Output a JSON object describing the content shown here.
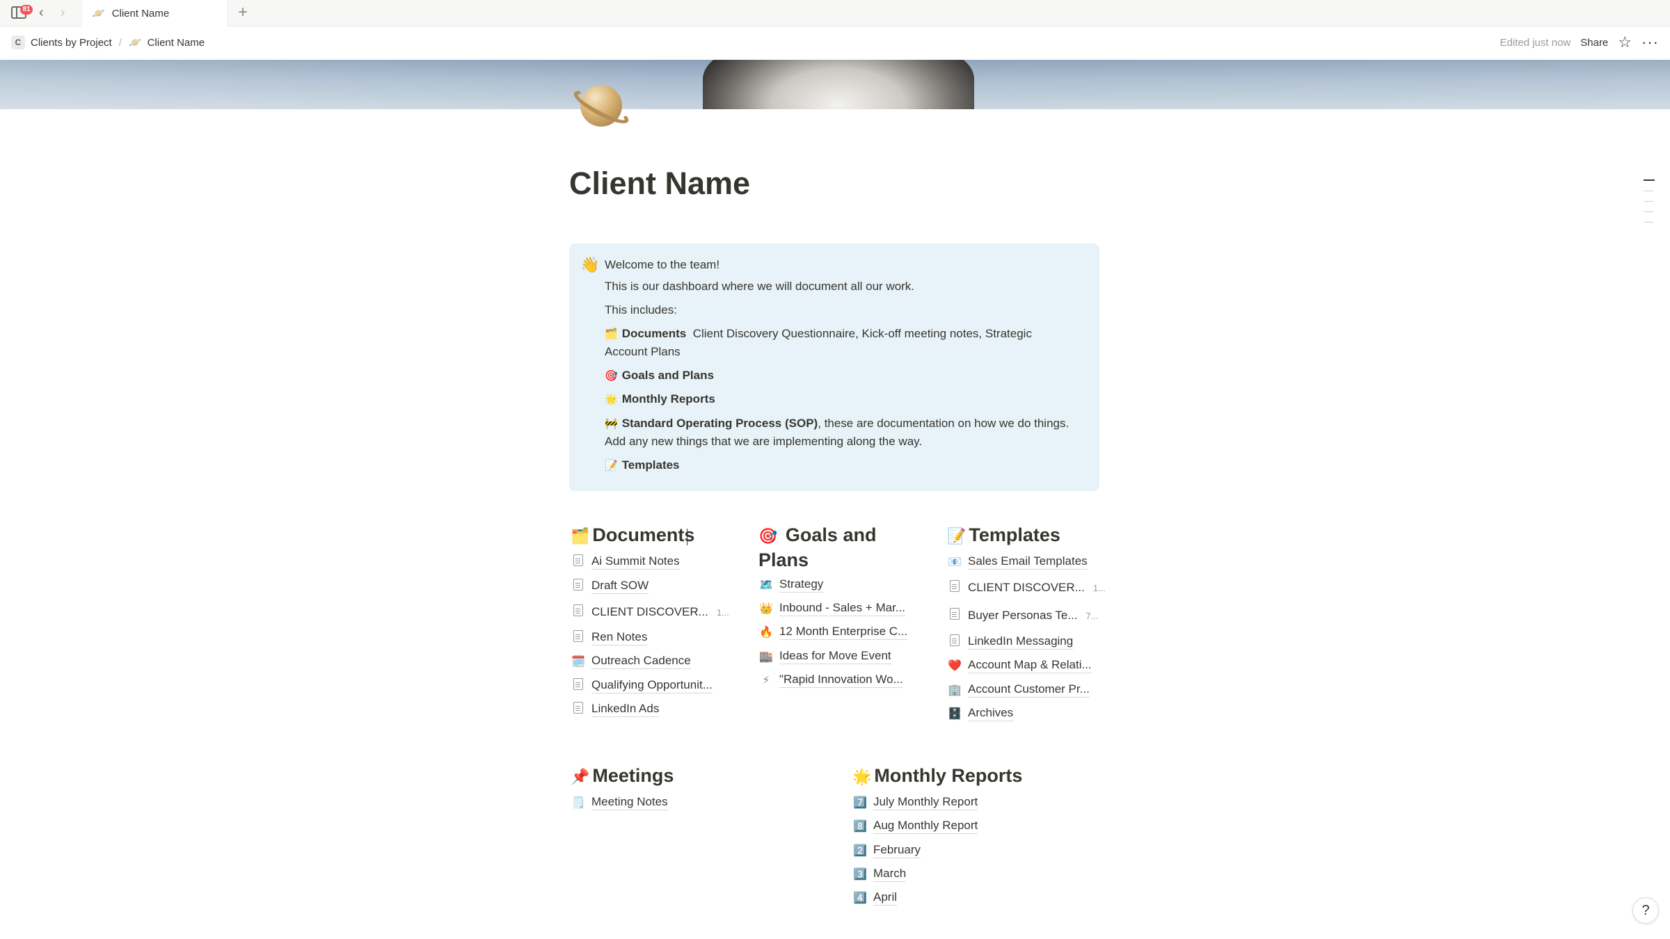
{
  "tabbar": {
    "badge": "81",
    "back_glyph": "‹",
    "forward_glyph": "›",
    "tab_icon": "🪐",
    "tab_title": "Client Name",
    "new_tab_glyph": "+"
  },
  "breadcrumb": {
    "workspace_initial": "C",
    "parent": "Clients by Project",
    "separator": "/",
    "current_icon": "🪐",
    "current": "Client Name"
  },
  "topbar": {
    "edited": "Edited just now",
    "share": "Share",
    "star_glyph": "☆",
    "more_glyph": "···"
  },
  "page": {
    "icon": "saturn-planet-icon",
    "title": "Client Name"
  },
  "callout": {
    "icon": "👋",
    "welcome": "Welcome to the team!",
    "intro": "This is our dashboard where we will document all our work.",
    "includes": "This includes:",
    "documents_emoji": "🗂️",
    "documents_bold": "Documents",
    "documents_rest": "Client Discovery Questionnaire, Kick-off meeting notes, Strategic",
    "documents_rest2": "Account Plans",
    "goals_emoji": "🎯",
    "goals_bold": "Goals and Plans",
    "monthly_emoji": "🌟",
    "monthly_bold": "Monthly Reports",
    "sop_emoji": "🚧",
    "sop_bold": "Standard Operating Process (SOP)",
    "sop_rest": ", these are documentation on how we do things.",
    "sop_rest2": "Add any new things that we are implementing along the way.",
    "templates_emoji": "📝",
    "templates_bold": "Templates"
  },
  "documents": {
    "emoji": "🗂️",
    "heading": "Documents",
    "items": [
      {
        "icon": "doc",
        "label": "Ai Summit Notes"
      },
      {
        "icon": "doc",
        "label": "Draft SOW"
      },
      {
        "icon": "gdoc",
        "label": "CLIENT DISCOVER...",
        "mini": "1..."
      },
      {
        "icon": "doc",
        "label": "Ren Notes"
      },
      {
        "icon": "🗓️",
        "label": "Outreach Cadence"
      },
      {
        "icon": "doc",
        "label": "Qualifying Opportunit..."
      },
      {
        "icon": "doc",
        "label": "LinkedIn Ads"
      }
    ]
  },
  "goals": {
    "emoji": "🎯",
    "heading_line1": "Goals and",
    "heading_line2": "Plans",
    "items": [
      {
        "icon": "🗺️",
        "label": "Strategy"
      },
      {
        "icon": "👑",
        "label": "Inbound - Sales + Mar..."
      },
      {
        "icon": "🔥",
        "label": "12 Month Enterprise C..."
      },
      {
        "icon": "🏬",
        "label": "Ideas for Move Event"
      },
      {
        "icon": "⚡",
        "label": "\"Rapid Innovation Wo..."
      }
    ]
  },
  "templates": {
    "emoji": "📝",
    "heading": "Templates",
    "items": [
      {
        "icon": "📧",
        "label": "Sales Email Templates"
      },
      {
        "icon": "gdoc",
        "label": "CLIENT DISCOVER...",
        "mini": "1..."
      },
      {
        "icon": "gdoc",
        "label": "Buyer Personas Te...",
        "mini": "7..."
      },
      {
        "icon": "doc",
        "label": "LinkedIn Messaging"
      },
      {
        "icon": "❤️",
        "label": "Account Map & Relati..."
      },
      {
        "icon": "🏢",
        "label": "Account Customer Pr..."
      },
      {
        "icon": "🗄️",
        "label": "Archives"
      }
    ]
  },
  "meetings": {
    "emoji": "📌",
    "heading": "Meetings",
    "items": [
      {
        "icon": "🗒️",
        "label": "Meeting Notes"
      }
    ]
  },
  "monthly": {
    "emoji": "🌟",
    "heading": "Monthly Reports",
    "items": [
      {
        "icon": "7️⃣",
        "label": "July Monthly Report"
      },
      {
        "icon": "8️⃣",
        "label": "Aug Monthly Report"
      },
      {
        "icon": "2️⃣",
        "label": "February"
      },
      {
        "icon": "3️⃣",
        "label": "March"
      },
      {
        "icon": "4️⃣",
        "label": "April"
      }
    ]
  },
  "help": {
    "glyph": "?"
  }
}
